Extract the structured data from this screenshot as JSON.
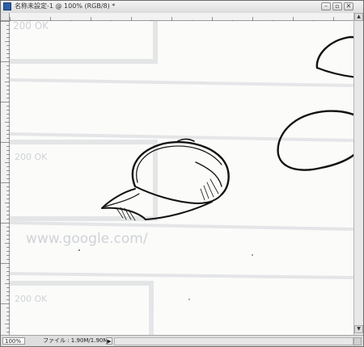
{
  "window": {
    "title": "名称未設定-1 @ 100% (RGB/8) *"
  },
  "title_buttons": {
    "minimize": "–",
    "restore": "▫",
    "close": "✕"
  },
  "status": {
    "zoom": "100%",
    "file_info": "ファイル : 1.90M/1.90M"
  },
  "scroll": {
    "up": "▲",
    "down": "▼",
    "status_arrow": "▶"
  },
  "background_text": {
    "ok_label": "200 OK",
    "url_text": "www.google.com/"
  },
  "colors": {
    "ink": "#111111",
    "paper": "#fbfbfa",
    "faint": "#c9ccd0"
  }
}
